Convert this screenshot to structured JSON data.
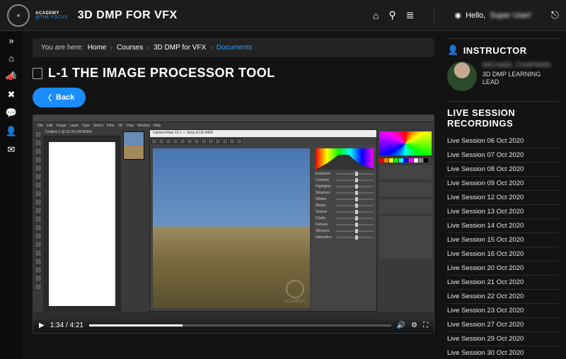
{
  "brand": {
    "line1": "ACADEMY",
    "line2": "@THE FOCUS"
  },
  "course_title": "3D DMP FOR VFX",
  "greeting": {
    "hello": "Hello,",
    "user": "Super User!"
  },
  "breadcrumb": {
    "label": "You are here:",
    "items": [
      "Home",
      "Courses",
      "3D DMP for VFX",
      "Documents"
    ]
  },
  "page": {
    "title": "L-1 THE IMAGE PROCESSOR TOOL"
  },
  "buttons": {
    "back": "Back"
  },
  "video": {
    "current_time": "1:34",
    "duration": "4:21",
    "acr_title": "Camera Raw 12.1 — Sony ILCE-6400",
    "ps_tab": "Untitled-1 @ 33.3% (RGB/8#)",
    "ps_menu": [
      "File",
      "Edit",
      "Image",
      "Layer",
      "Type",
      "Select",
      "Filter",
      "3D",
      "View",
      "Window",
      "Help"
    ],
    "sliders": [
      "Exposure",
      "Contrast",
      "Highlights",
      "Shadows",
      "Whites",
      "Blacks",
      "Texture",
      "Clarity",
      "Dehaze",
      "Vibrance",
      "Saturation"
    ],
    "watermark": "ACADEMY"
  },
  "instructor": {
    "heading": "INSTRUCTOR",
    "name": "MICHAEL CHAPMAN",
    "role": "3D DMP LEARNING LEAD"
  },
  "recordings": {
    "heading": "LIVE SESSION RECORDINGS",
    "items": [
      "Live Session 06 Oct 2020",
      "Live Session 07 Oct 2020",
      "Live Session 08 Oct 2020",
      "Live Session 09 Oct 2020",
      "Live Session 12 Oct 2020",
      "Live Session 13 Oct 2020",
      "Live Session 14 Oct 2020",
      "Live Session 15 Oct 2020",
      "Live Session 16 Oct 2020",
      "Live Session 20 Oct 2020",
      "Live Session 21 Oct 2020",
      "Live Session 22 Oct 2020",
      "Live Session 23 Oct 2020",
      "Live Session 27 Oct 2020",
      "Live Session 29 Oct 2020",
      "Live Session 30 Oct 2020"
    ]
  }
}
